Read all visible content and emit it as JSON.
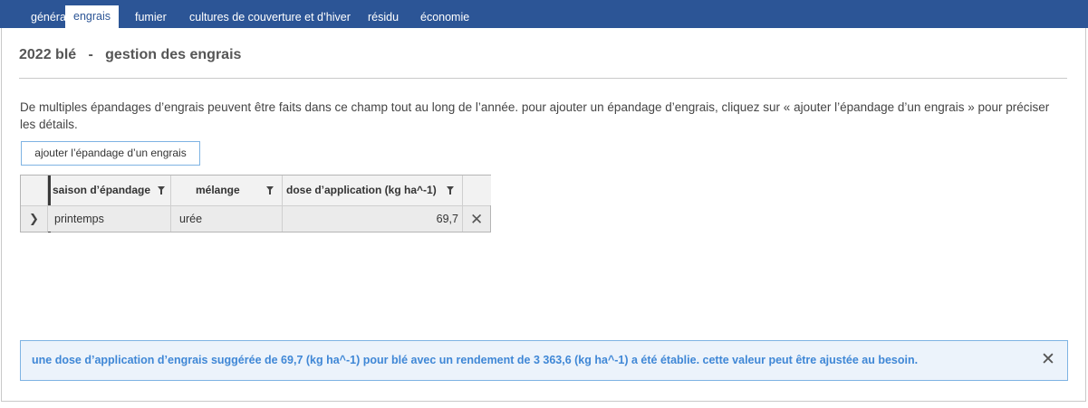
{
  "tabs": [
    {
      "label": "général"
    },
    {
      "label": "engrais",
      "active": true
    },
    {
      "label": "fumier"
    },
    {
      "label": "cultures de couverture et d’hiver"
    },
    {
      "label": "résidu"
    },
    {
      "label": "économie"
    }
  ],
  "header": {
    "title": "2022 blé   -   gestion des engrais"
  },
  "description": "De multiples épandages d’engrais peuvent être faits dans ce champ tout au long de l’année. pour ajouter un épandage d’engrais, cliquez sur « ajouter l’épandage d’un engrais » pour préciser les détails.",
  "add_button": {
    "label": "ajouter l’épandage d’un engrais"
  },
  "table": {
    "columns": [
      {
        "label": "saison d’épandage"
      },
      {
        "label": "mélange"
      },
      {
        "label": "dose d’application (kg ha^-1)"
      }
    ],
    "rows": [
      {
        "season": "printemps",
        "mix": "urée",
        "dose": "69,7"
      }
    ]
  },
  "notice": {
    "text": "une dose d’application d’engrais suggérée de 69,7 (kg ha^-1) pour blé avec un rendement de 3 363,6 (kg ha^-1) a été établie. cette valeur peut être ajustée au besoin."
  },
  "icons": {
    "filter": "filter-icon",
    "expand": "chevron-right-icon",
    "delete": "close-icon"
  },
  "colors": {
    "tabbar": "#2c5596",
    "accent": "#3f87d6",
    "notice_bg": "#ecf3fb"
  }
}
